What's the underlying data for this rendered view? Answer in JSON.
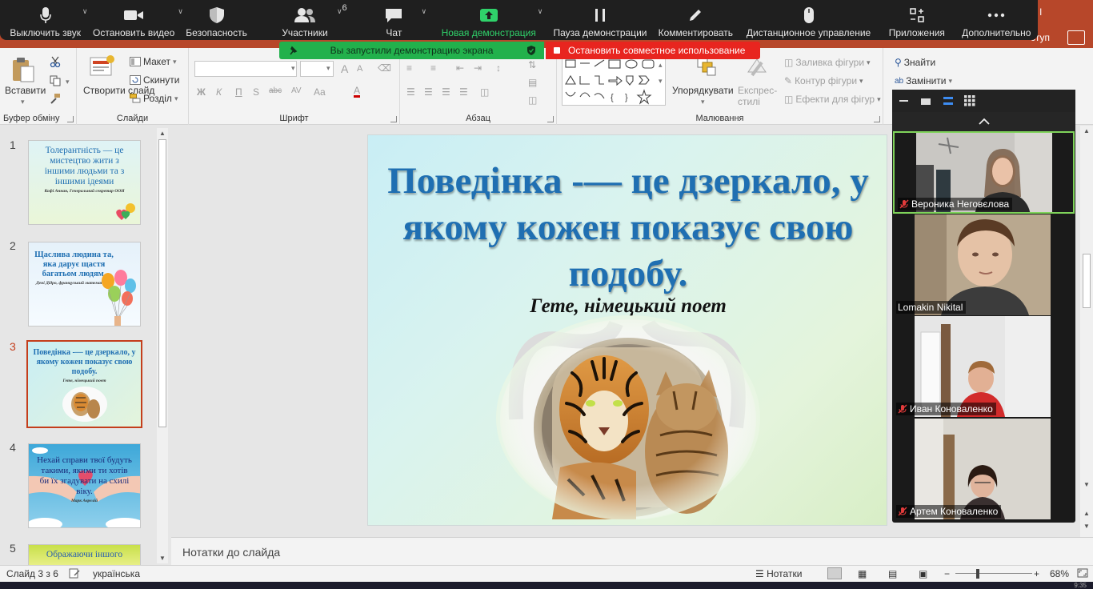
{
  "ppt": {
    "share_label": "ступ",
    "title_glyph": "l"
  },
  "zoom": {
    "buttons": [
      {
        "label": "Выключить звук",
        "icon": "microphone-icon"
      },
      {
        "label": "Остановить видео",
        "icon": "video-camera-icon"
      },
      {
        "label": "Безопасность",
        "icon": "shield-icon"
      },
      {
        "label": "Участники",
        "icon": "participants-icon",
        "count": "6"
      },
      {
        "label": "Чат",
        "icon": "chat-icon"
      },
      {
        "label": "Новая демонстрация",
        "icon": "share-screen-icon"
      },
      {
        "label": "Пауза демонстрации",
        "icon": "pause-icon"
      },
      {
        "label": "Комментировать",
        "icon": "pen-icon"
      },
      {
        "label": "Дистанционное управление",
        "icon": "mouse-icon"
      },
      {
        "label": "Приложения",
        "icon": "apps-icon"
      },
      {
        "label": "Дополнительно",
        "icon": "more-dots-icon"
      }
    ],
    "share_banner": "Вы запустили демонстрацию экрана",
    "stop_banner": "Остановить совместное использование",
    "green": "#2fd26a",
    "red": "#e8251f"
  },
  "ribbon": {
    "clipboard": {
      "paste": "Вставити",
      "label": "Буфер обміну"
    },
    "slides": {
      "new_slide": "Створити слайд",
      "layout": "Макет",
      "reset": "Скинути",
      "section": "Розділ",
      "label": "Слайди"
    },
    "font": {
      "bold": "Ж",
      "italic": "К",
      "underline": "П",
      "strike": "abc",
      "spacing": "AV",
      "case": "Aa",
      "grow": "A",
      "shrink": "A",
      "label": "Шрифт"
    },
    "paragraph": {
      "label": "Абзац"
    },
    "drawing": {
      "arrange": "Упорядкувати",
      "quick_styles": "Експрес-стилі",
      "fill": "Заливка фігури",
      "outline": "Контур фігури",
      "effects": "Ефекти для фігур",
      "label": "Малювання"
    },
    "editing": {
      "find": "Знайти",
      "replace": "Замінити"
    }
  },
  "thumbnails": [
    {
      "num": "1",
      "title": "Толерантність — це мистецтво жити з іншими людьми та з іншими ідеями",
      "author": "Кофі Аннан, Генеральний секретар ООН"
    },
    {
      "num": "2",
      "title": "Щаслива людина та, яка дарує щастя багатьом людям.",
      "author": "Дені Дідро, французький математик"
    },
    {
      "num": "3",
      "title": "Поведінка -— це дзеркало, у якому кожен показує свою подобу.",
      "author": "Гете, німецький поет"
    },
    {
      "num": "4",
      "title": "Нехай справи твої будуть такими, якими ти хотів би їх згадувати на схилі віку.",
      "author": "Марк Аврелій"
    },
    {
      "num": "5",
      "title": "Ображаючи іншого"
    }
  ],
  "slide": {
    "title": "Поведінка -— це дзеркало, у якому кожен показує свою подобу.",
    "author": "Гете, німецький поет"
  },
  "notes_placeholder": "Нотатки до слайда",
  "participants": [
    {
      "name": "Вероника Неговєлова",
      "muted": true
    },
    {
      "name": "Lomakin Nikital",
      "muted": false
    },
    {
      "name": "Иван Коноваленко",
      "muted": true
    },
    {
      "name": "Артем Коноваленко",
      "muted": true
    }
  ],
  "status": {
    "slide_info": "Слайд 3 з 6",
    "language": "українська",
    "notes_btn": "Нотатки",
    "zoom": "68%",
    "clock": "9:35"
  }
}
